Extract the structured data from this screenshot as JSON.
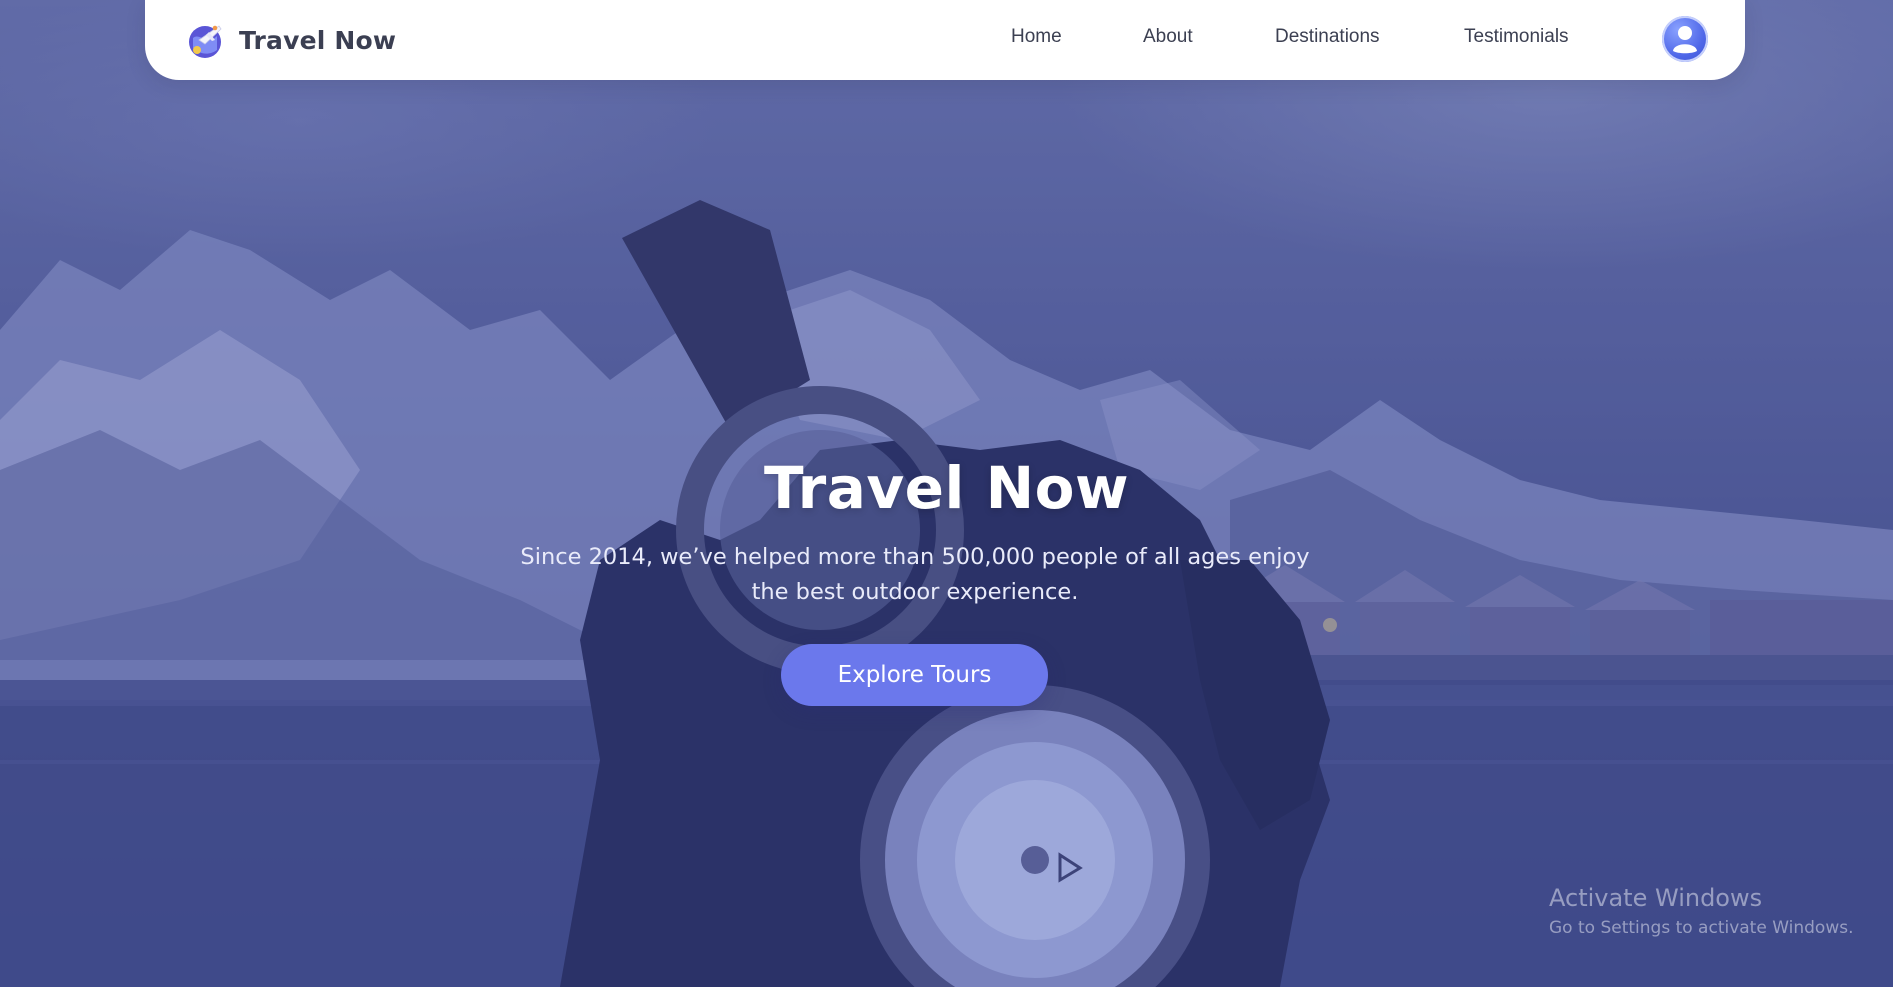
{
  "navbar": {
    "brand_name": "Travel Now",
    "logo_icon": "airplane-globe-icon",
    "links": [
      {
        "label": "Home"
      },
      {
        "label": "About"
      },
      {
        "label": "Destinations"
      },
      {
        "label": "Testimonials"
      }
    ],
    "avatar_icon": "user-avatar-icon"
  },
  "hero": {
    "title": "Travel Now",
    "subtitle": "Since 2014, we’ve helped more than 500,000 people of all ages enjoy the best outdoor experience.",
    "cta_label": "Explore Tours"
  },
  "watermark": {
    "title": "Activate Windows",
    "subtitle": "Go to Settings to activate Windows."
  },
  "colors": {
    "accent": "#6b78ec",
    "overlay": "#464ea0",
    "nav_text": "#3c4052"
  }
}
